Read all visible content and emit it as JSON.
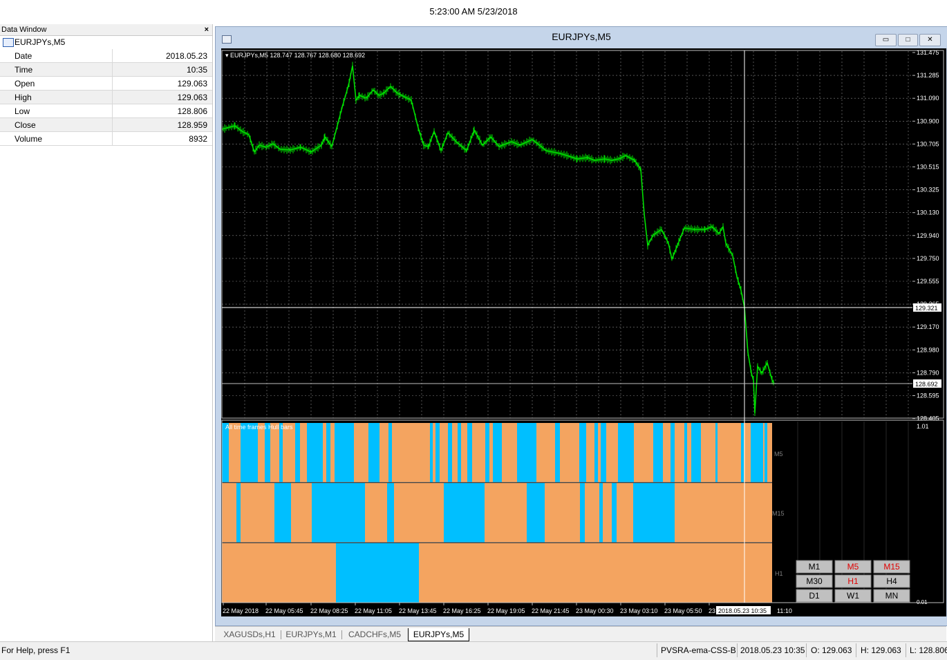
{
  "title_time": "5:23:00 AM 5/23/2018",
  "data_window": {
    "title": "Data Window",
    "close_glyph": "×",
    "symbol": "EURJPYs,M5",
    "rows": [
      {
        "key": "Date",
        "value": "2018.05.23"
      },
      {
        "key": "Time",
        "value": "10:35"
      },
      {
        "key": "Open",
        "value": "129.063"
      },
      {
        "key": "High",
        "value": "129.063"
      },
      {
        "key": "Low",
        "value": "128.806"
      },
      {
        "key": "Close",
        "value": "128.959"
      },
      {
        "key": "Volume",
        "value": "8932"
      }
    ]
  },
  "chart_window": {
    "title": "EURJPYs,M5",
    "btn_min": "▭",
    "btn_max": "□",
    "btn_close": "✕"
  },
  "chart": {
    "header": "▾ EURJPYs,M5  128.747 128.767 128.680 128.692",
    "indicator_label": "All time frames Hull bars",
    "colors": {
      "bull": "#00bfff",
      "bear": "#f4a460",
      "price": "#00e000",
      "grid": "#8a8a8a"
    },
    "yticks": [
      "131.475",
      "131.285",
      "131.090",
      "130.900",
      "130.705",
      "130.515",
      "130.325",
      "130.130",
      "129.940",
      "129.750",
      "129.555",
      "129.365",
      "129.170",
      "128.980",
      "128.790",
      "128.595",
      "128.405"
    ],
    "crosshair_price": "129.321",
    "current_price": "128.692",
    "indicator_max": "1.01",
    "indicator_min": "0.01",
    "row_labels": [
      "M5",
      "M15",
      "H1"
    ],
    "xticks": [
      "22 May 2018",
      "22 May 05:45",
      "22 May 08:25",
      "22 May 11:05",
      "22 May 13:45",
      "22 May 16:25",
      "22 May 19:05",
      "22 May 21:45",
      "23 May 00:30",
      "23 May 03:10",
      "23 May 05:50",
      "23"
    ],
    "crosshair_time": "2018.05.23 10:35",
    "last_time": "11:10",
    "tf_buttons": [
      {
        "label": "M1",
        "active": false
      },
      {
        "label": "M5",
        "active": true
      },
      {
        "label": "M15",
        "active": true
      },
      {
        "label": "M30",
        "active": false
      },
      {
        "label": "H1",
        "active": true
      },
      {
        "label": "H4",
        "active": false
      },
      {
        "label": "D1",
        "active": false
      },
      {
        "label": "W1",
        "active": false
      },
      {
        "label": "MN",
        "active": false
      }
    ]
  },
  "tabs": [
    "XAGUSDs,H1",
    "EURJPYs,M1",
    "CADCHFs,M5",
    "EURJPYs,M5"
  ],
  "active_tab": "EURJPYs,M5",
  "status": {
    "help": "For Help, press F1",
    "profile": "PVSRA-ema-CSS-BS",
    "datetime": "2018.05.23 10:35",
    "open": "O: 129.063",
    "high": "H: 129.063",
    "low": "L: 128.806"
  }
}
